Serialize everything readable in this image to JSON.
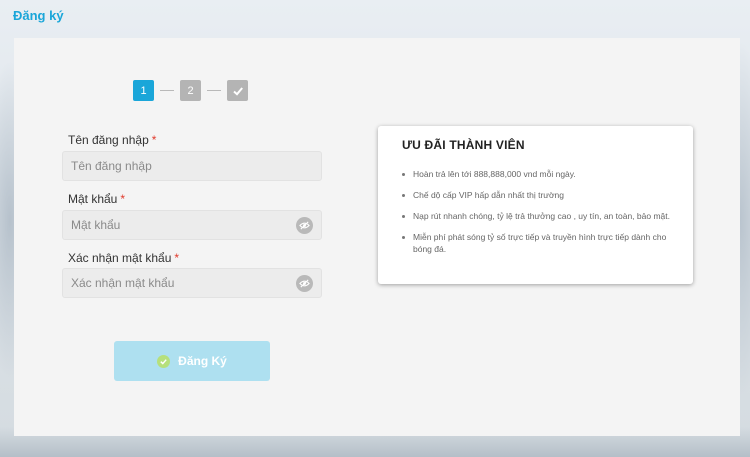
{
  "header": {
    "title": "Đăng ký"
  },
  "steps": [
    {
      "label": "1",
      "state": "active"
    },
    {
      "label": "2",
      "state": "pending"
    },
    {
      "label": "",
      "state": "pending",
      "icon": "check-icon"
    }
  ],
  "form": {
    "username": {
      "label": "Tên đăng nhập",
      "required_mark": "*",
      "placeholder": "Tên đăng nhập",
      "value": ""
    },
    "password": {
      "label": "Mật khẩu",
      "required_mark": "*",
      "placeholder": "Mật khẩu",
      "value": "",
      "toggle_icon": "eye-off-icon"
    },
    "confirm_password": {
      "label": "Xác nhận mật khẩu",
      "required_mark": "*",
      "placeholder": "Xác nhận mật khẩu",
      "value": "",
      "toggle_icon": "eye-off-icon"
    },
    "submit_label": "Đăng Ký"
  },
  "benefits": {
    "title": "ƯU ĐÃI THÀNH VIÊN",
    "items": [
      "Hoàn trả lên tới 888,888,000 vnd mỗi ngày.",
      "Chế dộ cấp VIP hấp dẫn nhất thị trường",
      "Nạp rút nhanh chóng, tỷ lệ trả thưởng cao , uy tín, an toàn, bảo mật.",
      "Miễn phí phát sóng tỷ số trực tiếp và truyền hình trực tiếp dành cho bóng đá."
    ]
  },
  "colors": {
    "accent": "#1aa6d9",
    "step_pending": "#b4b4b4",
    "button": "#aee0f0",
    "required": "#e0392b",
    "panel": "#f4f4f4"
  }
}
